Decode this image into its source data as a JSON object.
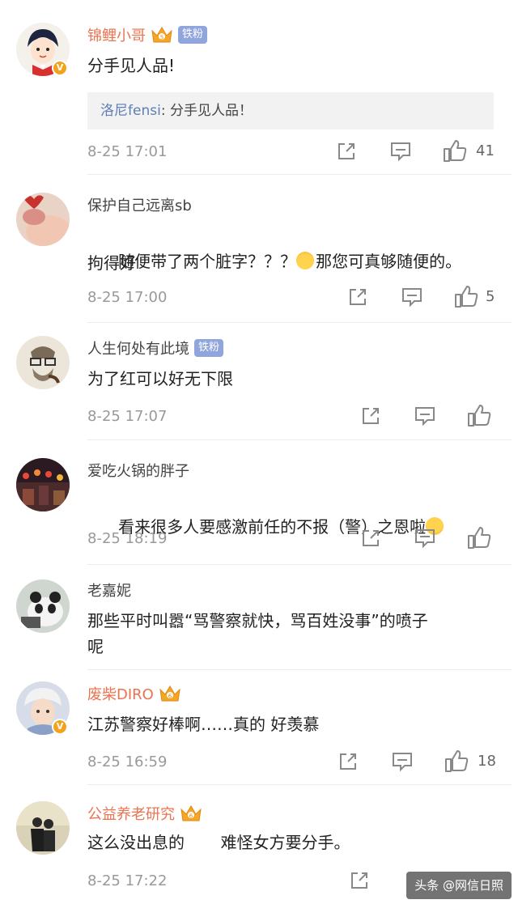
{
  "comments": [
    {
      "user": "锦鲤小哥",
      "badge": "铁粉",
      "text": "分手见人品!",
      "quote": {
        "user": "洛尼fensi",
        "sep": ": ",
        "text": "分手见人品！"
      },
      "time": "8-25 17:01",
      "likes": "41"
    },
    {
      "user": "保护自己远离sb",
      "text": "随便带了两个脏字？？？",
      "text_after_emoji": "那您可真够随便的。",
      "text2": "拘得好",
      "time": "8-25 17:00",
      "likes": "5"
    },
    {
      "user": "人生何处有此境",
      "badge": "铁粉",
      "text": "为了红可以好无下限",
      "time": "8-25 17:07"
    },
    {
      "user": "爱吃火锅的胖子",
      "text": "看来很多人要感激前任的不报（警）之恩啦",
      "time": "8-25 18:19"
    },
    {
      "user": "老嘉妮",
      "text": "那些平时叫嚣“骂警察就快，骂百姓没事”的喷子",
      "text2": "呢"
    },
    {
      "user": "废柴DIRO",
      "text": "江苏警察好棒啊……真的 好羡慕",
      "time": "8-25 16:59",
      "likes": "18"
    },
    {
      "user": "公益养老研究",
      "text": "这么没出息的       难怪女方要分手。",
      "time": "8-25 17:22"
    }
  ],
  "watermark": "头条 @网信日照",
  "icons": [
    "share-icon",
    "comment-icon",
    "like-icon",
    "crown-icon",
    "verified-badge-icon"
  ],
  "colors": {
    "vip_name": "#eb7350",
    "normal_name": "#444444",
    "fan_badge": "#8fa5dc",
    "quote_user": "#5d7eb6",
    "time": "#999999"
  }
}
